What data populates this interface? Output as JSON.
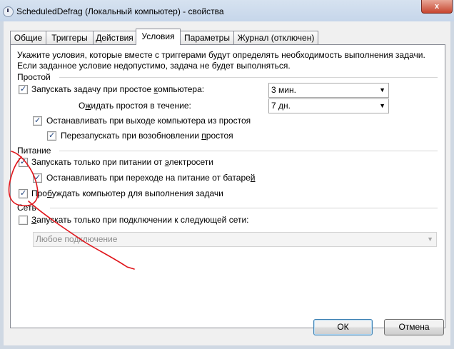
{
  "window": {
    "title": "ScheduledDefrag (Локальный компьютер) - свойства",
    "close_label": "x"
  },
  "tabs": [
    {
      "label": "Общие"
    },
    {
      "label": "Триггеры"
    },
    {
      "label": "Действия"
    },
    {
      "label": "Условия"
    },
    {
      "label": "Параметры"
    },
    {
      "label": "Журнал (отключен)"
    }
  ],
  "intro": {
    "line1": "Укажите условия, которые вместе с триггерами будут определять необходимость выполнения задачи.",
    "line2": "Если заданное условие недопустимо, задача не будет выполняться."
  },
  "idle": {
    "header": "Простой",
    "start_on_idle": {
      "label_pre": "Запускать задачу при простое ",
      "label_u": "к",
      "label_post": "омпьютера:",
      "checked": true,
      "value": "3 мин."
    },
    "wait": {
      "label_pre": "О",
      "label_u": "ж",
      "label_post": "идать простоя в течение:",
      "value": "7 дн."
    },
    "stop_on_exit": {
      "label": "Останавливать при выходе компьютера из простоя",
      "checked": true
    },
    "restart": {
      "label_pre": "Перезапускать при возобновлении ",
      "label_u": "п",
      "label_post": "ростоя",
      "checked": true
    }
  },
  "power": {
    "header": "Питание",
    "ac_only": {
      "label_pre": "Запускать только при питании от ",
      "label_u": "э",
      "label_post": "лектросети",
      "checked": true
    },
    "stop_on_battery": {
      "label_pre": "Останавливать при переходе на питание от батаре",
      "label_u": "й",
      "label_post": "",
      "checked": true
    },
    "wake": {
      "label_pre": "Про",
      "label_u": "б",
      "label_post": "уждать компьютер для выполнения задачи",
      "checked": true
    }
  },
  "network": {
    "header": "Сеть",
    "connection_only": {
      "label_pre": "",
      "label_u": "З",
      "label_post": "апускать только при подключении к следующей сети:",
      "checked": false
    },
    "connection_value": "Любое подключение"
  },
  "buttons": {
    "ok": "ОК",
    "cancel": "Отмена"
  },
  "check_glyph": "✓",
  "annotation_color": "#e0151b"
}
